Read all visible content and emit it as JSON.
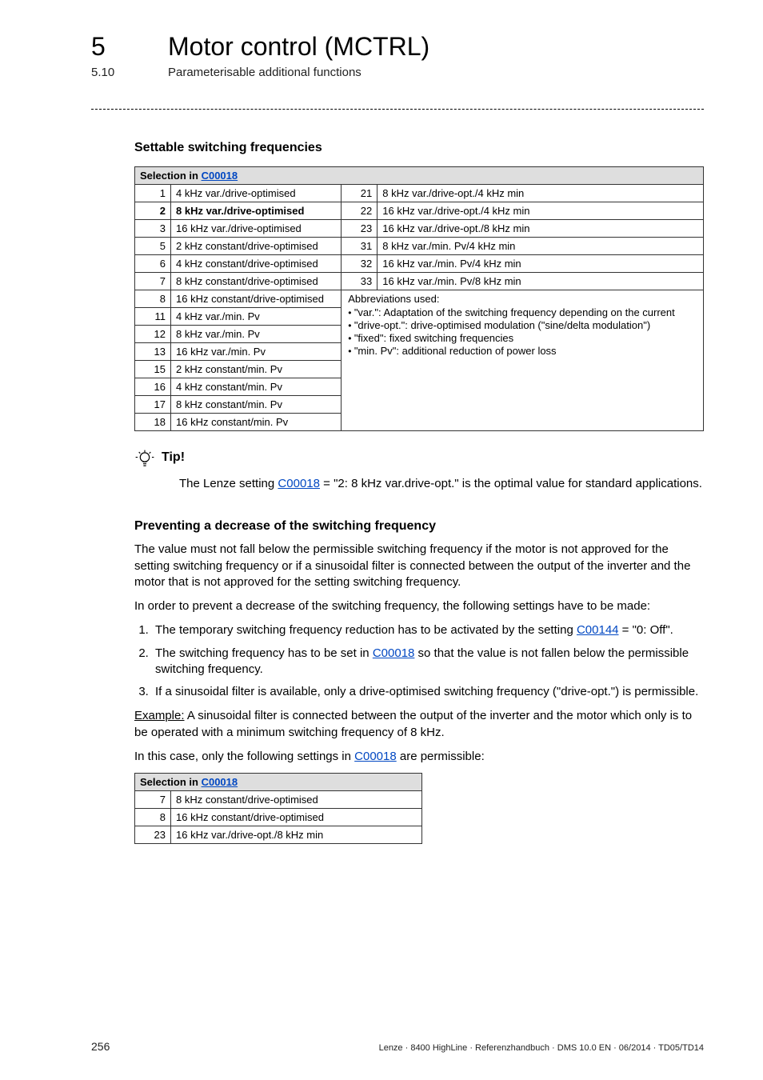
{
  "header": {
    "chapter_num": "5",
    "chapter_title": "Motor control (MCTRL)",
    "section_num": "5.10",
    "section_title": "Parameterisable additional functions"
  },
  "settable": {
    "heading": "Settable switching frequencies",
    "table_header_prefix": "Selection in ",
    "table_header_link": "C00018",
    "left_rows": [
      {
        "n": "1",
        "t": "4 kHz var./drive-optimised"
      },
      {
        "n": "2",
        "t": "8 kHz var./drive-optimised",
        "bold": true
      },
      {
        "n": "3",
        "t": "16 kHz var./drive-optimised"
      },
      {
        "n": "5",
        "t": "2 kHz constant/drive-optimised"
      },
      {
        "n": "6",
        "t": "4 kHz constant/drive-optimised"
      },
      {
        "n": "7",
        "t": "8 kHz constant/drive-optimised"
      },
      {
        "n": "8",
        "t": "16 kHz constant/drive-optimised"
      },
      {
        "n": "11",
        "t": "4 kHz var./min. Pv"
      },
      {
        "n": "12",
        "t": "8 kHz var./min. Pv"
      },
      {
        "n": "13",
        "t": "16 kHz var./min. Pv"
      },
      {
        "n": "15",
        "t": "2 kHz constant/min. Pv"
      },
      {
        "n": "16",
        "t": "4 kHz constant/min. Pv"
      },
      {
        "n": "17",
        "t": "8 kHz constant/min. Pv"
      },
      {
        "n": "18",
        "t": "16 kHz constant/min. Pv"
      }
    ],
    "right_rows": [
      {
        "n": "21",
        "t": "8 kHz var./drive-opt./4 kHz min"
      },
      {
        "n": "22",
        "t": "16 kHz var./drive-opt./4 kHz min"
      },
      {
        "n": "23",
        "t": "16 kHz var./drive-opt./8 kHz min"
      },
      {
        "n": "31",
        "t": "8 kHz var./min. Pv/4 kHz min"
      },
      {
        "n": "32",
        "t": "16 kHz var./min. Pv/4 kHz min"
      },
      {
        "n": "33",
        "t": "16 kHz var./min. Pv/8 kHz min"
      }
    ],
    "abbr_title": "Abbreviations used:",
    "abbr_items": [
      "\"var.\": Adaptation of the switching frequency depending on the current",
      "\"drive-opt.\": drive-optimised modulation (\"sine/delta modulation\")",
      "\"fixed\": fixed switching frequencies",
      "\"min. Pv\": additional reduction of power loss"
    ]
  },
  "tip": {
    "label": "Tip!",
    "text_before": "The Lenze setting ",
    "link": "C00018",
    "text_after": " = \"2: 8 kHz var.drive-opt.\" is the optimal value for standard applications."
  },
  "prevent": {
    "heading": "Preventing a decrease of the switching frequency",
    "para1": "The value must not fall below the permissible switching frequency if the motor is not approved for the setting switching frequency or if a sinusoidal filter is connected between the output of the inverter and the motor that is not approved for the setting switching frequency.",
    "para2": "In order to prevent a decrease of the switching frequency, the following settings have to be made:",
    "step1_before": "The temporary switching frequency reduction has to be activated by the setting ",
    "step1_link": "C00144",
    "step1_after": " = \"0: Off\".",
    "step2_before": "The switching frequency has to be set in ",
    "step2_link": "C00018",
    "step2_after": " so that the value is not fallen below the permissible switching frequency.",
    "step3": "If a sinusoidal filter is available, only a drive-optimised switching frequency (\"drive-opt.\") is permissible.",
    "example_label": "Example:",
    "example_text": " A sinusoidal filter is connected between the output of the inverter and the motor which only is to be operated with a minimum switching frequency of 8 kHz.",
    "para3_before": "In this case, only the following settings in ",
    "para3_link": "C00018",
    "para3_after": " are permissible:",
    "small_header_prefix": "Selection in ",
    "small_header_link": "C00018",
    "small_rows": [
      {
        "n": "7",
        "t": "8 kHz constant/drive-optimised"
      },
      {
        "n": "8",
        "t": "16 kHz constant/drive-optimised"
      },
      {
        "n": "23",
        "t": "16 kHz var./drive-opt./8 kHz min"
      }
    ]
  },
  "footer": {
    "page": "256",
    "imprint": "Lenze · 8400 HighLine · Referenzhandbuch · DMS 10.0 EN · 06/2014 · TD05/TD14"
  }
}
